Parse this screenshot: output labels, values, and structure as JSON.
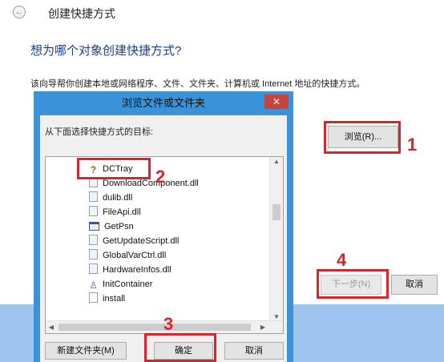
{
  "wizard": {
    "back_icon": "←",
    "title": "创建快捷方式",
    "heading": "想为哪个对象创建快捷方式?",
    "description": "该向导帮你创建本地或网络程序、文件、文件夹、计算机或 Internet 地址的快捷方式。",
    "browse_label": "浏览(R)...",
    "next_label": "下一步(N)",
    "cancel_label": "取消"
  },
  "dialog": {
    "title": "浏览文件或文件夹",
    "close_icon": "✕",
    "prompt": "从下面选择快捷方式的目标:",
    "items": [
      {
        "label": "DCTray",
        "icon": "unknown-file-icon"
      },
      {
        "label": "DownloadComponent.dll",
        "icon": "dll-file-icon"
      },
      {
        "label": "dulib.dll",
        "icon": "dll-file-icon"
      },
      {
        "label": "FileApi.dll",
        "icon": "dll-file-icon"
      },
      {
        "label": "GetPsn",
        "icon": "application-icon"
      },
      {
        "label": "GetUpdateScript.dll",
        "icon": "dll-file-icon"
      },
      {
        "label": "GlobalVarCtrl.dll",
        "icon": "dll-file-icon"
      },
      {
        "label": "HardwareInfos.dll",
        "icon": "dll-file-icon"
      },
      {
        "label": "InitContainer",
        "icon": "installer-icon"
      },
      {
        "label": "install",
        "icon": "document-icon"
      }
    ],
    "new_folder_label": "新建文件夹(M)",
    "ok_label": "确定",
    "cancel_label": "取消"
  },
  "annotations": {
    "step1": "1",
    "step2": "2",
    "step3": "3",
    "step4": "4",
    "color": "#d6262b"
  }
}
